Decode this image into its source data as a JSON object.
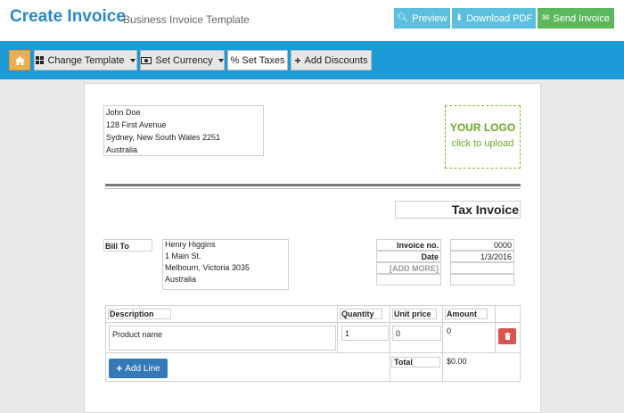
{
  "header": {
    "title": "Create Invoice",
    "subtitle": "Business Invoice Template",
    "preview_label": "Preview",
    "download_label": "Download PDF",
    "send_label": "Send Invoice"
  },
  "toolbar": {
    "home_icon": "home-icon",
    "change_template_label": "Change Template",
    "set_currency_label": "Set Currency",
    "set_taxes_label": "% Set Taxes",
    "add_discounts_label": "Add Discounts"
  },
  "sender": {
    "lines": [
      "John Doe",
      "128 First Avenue",
      "Sydney, New South Wales 2251",
      "Australia"
    ]
  },
  "logo": {
    "line1": "YOUR LOGO",
    "line2": "click to upload"
  },
  "invoice_title": "Tax Invoice",
  "bill_to": {
    "label": "Bill To",
    "lines": [
      "Henry Higgins",
      "1 Main St.",
      "Melbourn, Victoria 3035",
      "Australia"
    ]
  },
  "meta": {
    "invoice_no_label": "Invoice no.",
    "invoice_no_value": "0000",
    "date_label": "Date",
    "date_value": "1/3/2016",
    "add_more_label": "[ADD MORE]"
  },
  "items": {
    "headers": {
      "description": "Description",
      "quantity": "Quantity",
      "unit_price": "Unit price",
      "amount": "Amount"
    },
    "rows": [
      {
        "description": "Product name",
        "quantity": "1",
        "unit_price": "0",
        "amount": "0"
      }
    ],
    "add_line_label": "Add Line",
    "total_label": "Total",
    "total_value": "$0.00"
  },
  "colors": {
    "title_blue": "#2a88c6",
    "toolbar_blue": "#1a9ad6",
    "info": "#5bc0de",
    "success": "#5cb85c",
    "home_orange": "#f0ad4e",
    "danger": "#d9534f",
    "primary": "#337ab7",
    "logo_green": "#6aa828"
  }
}
